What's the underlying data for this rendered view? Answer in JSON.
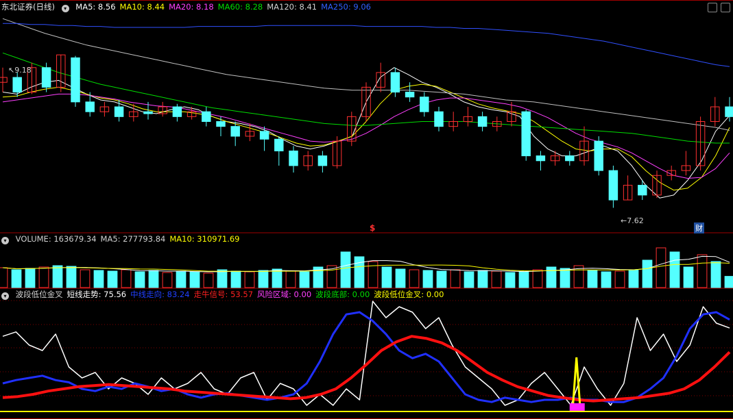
{
  "panel1": {
    "title": "东北证券(日线)",
    "ma": [
      {
        "label": "MA5: 8.56",
        "color": "#ffffff"
      },
      {
        "label": "MA10: 8.44",
        "color": "#ffff00"
      },
      {
        "label": "MA20: 8.18",
        "color": "#ff40ff"
      },
      {
        "label": "MA60: 8.28",
        "color": "#00dd00"
      },
      {
        "label": "MA120: 8.41",
        "color": "#d0d0d0"
      },
      {
        "label": "MA250: 9.06",
        "color": "#3060ff"
      }
    ],
    "high_label": "9.18",
    "low_label": "7.62",
    "marker_s": "$",
    "marker_cai": "财"
  },
  "panel2": {
    "labels": [
      {
        "label": "VOLUME: 163679.34",
        "color": "#d0d0d0"
      },
      {
        "label": "MA5: 277793.84",
        "color": "#d0d0d0"
      },
      {
        "label": "MA10: 310971.69",
        "color": "#ffff00"
      }
    ]
  },
  "panel3": {
    "labels": [
      {
        "label": "波段低位金叉",
        "color": "#d0d0d0"
      },
      {
        "label": "短线走势: 75.56",
        "color": "#ffffff"
      },
      {
        "label": "中线走向: 83.24",
        "color": "#2040ff"
      },
      {
        "label": "走牛信号: 53.57",
        "color": "#ff2020"
      },
      {
        "label": "风险区域: 0.00",
        "color": "#ff40ff"
      },
      {
        "label": "波段底部: 0.00",
        "color": "#00dd00"
      },
      {
        "label": "波段低位金叉: 0.00",
        "color": "#ffff00"
      }
    ]
  },
  "chart_data": [
    {
      "type": "candlestick",
      "ylim": [
        7.4,
        9.6
      ],
      "ma": {
        "MA5": [
          8.8,
          8.78,
          8.85,
          8.9,
          8.92,
          8.85,
          8.78,
          8.72,
          8.7,
          8.65,
          8.6,
          8.58,
          8.62,
          8.65,
          8.62,
          8.55,
          8.5,
          8.48,
          8.45,
          8.4,
          8.32,
          8.25,
          8.22,
          8.25,
          8.3,
          8.35,
          8.7,
          8.95,
          9.05,
          8.98,
          8.9,
          8.85,
          8.78,
          8.7,
          8.65,
          8.62,
          8.6,
          8.55,
          8.35,
          8.22,
          8.15,
          8.15,
          8.2,
          8.25,
          8.2,
          8.05,
          7.85,
          7.72,
          7.75,
          7.9,
          8.1,
          8.4,
          8.56
        ],
        "MA10": [
          8.75,
          8.76,
          8.8,
          8.83,
          8.85,
          8.82,
          8.78,
          8.74,
          8.72,
          8.68,
          8.63,
          8.6,
          8.6,
          8.6,
          8.58,
          8.55,
          8.5,
          8.46,
          8.42,
          8.38,
          8.33,
          8.28,
          8.25,
          8.26,
          8.3,
          8.35,
          8.5,
          8.68,
          8.82,
          8.86,
          8.88,
          8.86,
          8.8,
          8.74,
          8.68,
          8.64,
          8.61,
          8.58,
          8.5,
          8.4,
          8.3,
          8.22,
          8.2,
          8.22,
          8.22,
          8.14,
          8.0,
          7.88,
          7.8,
          7.82,
          7.93,
          8.15,
          8.44
        ],
        "MA20": [
          8.7,
          8.72,
          8.74,
          8.76,
          8.78,
          8.78,
          8.77,
          8.75,
          8.73,
          8.7,
          8.68,
          8.66,
          8.65,
          8.63,
          8.6,
          8.57,
          8.54,
          8.5,
          8.46,
          8.42,
          8.38,
          8.34,
          8.3,
          8.29,
          8.3,
          8.32,
          8.38,
          8.46,
          8.55,
          8.62,
          8.68,
          8.72,
          8.74,
          8.74,
          8.72,
          8.7,
          8.68,
          8.65,
          8.6,
          8.54,
          8.46,
          8.38,
          8.32,
          8.28,
          8.24,
          8.18,
          8.1,
          8.02,
          7.95,
          7.92,
          7.93,
          8.02,
          8.18
        ],
        "MA60": [
          9.2,
          9.15,
          9.1,
          9.05,
          9.0,
          8.96,
          8.92,
          8.88,
          8.85,
          8.82,
          8.79,
          8.76,
          8.73,
          8.7,
          8.67,
          8.64,
          8.62,
          8.6,
          8.58,
          8.56,
          8.54,
          8.52,
          8.5,
          8.48,
          8.47,
          8.46,
          8.46,
          8.47,
          8.48,
          8.49,
          8.5,
          8.5,
          8.5,
          8.5,
          8.49,
          8.48,
          8.47,
          8.46,
          8.45,
          8.44,
          8.43,
          8.42,
          8.41,
          8.4,
          8.39,
          8.38,
          8.36,
          8.34,
          8.32,
          8.3,
          8.29,
          8.28,
          8.28
        ],
        "MA120": [
          9.55,
          9.5,
          9.45,
          9.4,
          9.36,
          9.32,
          9.28,
          9.25,
          9.22,
          9.19,
          9.16,
          9.13,
          9.1,
          9.07,
          9.04,
          9.01,
          8.98,
          8.96,
          8.94,
          8.92,
          8.9,
          8.88,
          8.86,
          8.84,
          8.83,
          8.82,
          8.82,
          8.82,
          8.82,
          8.82,
          8.81,
          8.8,
          8.79,
          8.78,
          8.76,
          8.74,
          8.72,
          8.71,
          8.7,
          8.68,
          8.66,
          8.64,
          8.62,
          8.6,
          8.58,
          8.56,
          8.54,
          8.52,
          8.5,
          8.48,
          8.46,
          8.44,
          8.41
        ],
        "MA250": [
          9.5,
          9.5,
          9.49,
          9.49,
          9.48,
          9.48,
          9.47,
          9.47,
          9.46,
          9.46,
          9.46,
          9.46,
          9.46,
          9.46,
          9.47,
          9.47,
          9.47,
          9.47,
          9.47,
          9.48,
          9.48,
          9.48,
          9.48,
          9.48,
          9.48,
          9.48,
          9.47,
          9.47,
          9.47,
          9.47,
          9.47,
          9.46,
          9.46,
          9.45,
          9.45,
          9.44,
          9.43,
          9.42,
          9.41,
          9.4,
          9.38,
          9.36,
          9.34,
          9.32,
          9.29,
          9.26,
          9.23,
          9.2,
          9.17,
          9.14,
          9.11,
          9.08,
          9.06
        ]
      },
      "candles": [
        [
          8.9,
          8.95,
          9.05,
          8.8
        ],
        [
          8.95,
          8.8,
          9.0,
          8.75
        ],
        [
          8.8,
          9.05,
          9.1,
          8.78
        ],
        [
          9.05,
          8.85,
          9.1,
          8.8
        ],
        [
          8.85,
          9.18,
          9.18,
          8.8
        ],
        [
          9.15,
          8.7,
          9.17,
          8.65
        ],
        [
          8.7,
          8.6,
          8.8,
          8.55
        ],
        [
          8.6,
          8.65,
          8.7,
          8.55
        ],
        [
          8.65,
          8.55,
          8.72,
          8.5
        ],
        [
          8.55,
          8.6,
          8.68,
          8.5
        ],
        [
          8.6,
          8.58,
          8.7,
          8.52
        ],
        [
          8.58,
          8.65,
          8.7,
          8.55
        ],
        [
          8.65,
          8.55,
          8.68,
          8.5
        ],
        [
          8.55,
          8.6,
          8.65,
          8.52
        ],
        [
          8.6,
          8.5,
          8.65,
          8.45
        ],
        [
          8.5,
          8.45,
          8.55,
          8.35
        ],
        [
          8.45,
          8.35,
          8.5,
          8.25
        ],
        [
          8.35,
          8.4,
          8.48,
          8.3
        ],
        [
          8.4,
          8.32,
          8.45,
          8.2
        ],
        [
          8.32,
          8.2,
          8.35,
          8.05
        ],
        [
          8.2,
          8.05,
          8.25,
          7.98
        ],
        [
          8.05,
          8.15,
          8.2,
          8.0
        ],
        [
          8.15,
          8.05,
          8.2,
          7.98
        ],
        [
          8.05,
          8.3,
          8.35,
          8.02
        ],
        [
          8.3,
          8.55,
          8.6,
          8.25
        ],
        [
          8.55,
          8.85,
          8.9,
          8.5
        ],
        [
          8.85,
          9.0,
          9.1,
          8.8
        ],
        [
          9.0,
          8.8,
          9.05,
          8.75
        ],
        [
          8.8,
          8.75,
          8.9,
          8.7
        ],
        [
          8.75,
          8.6,
          8.8,
          8.55
        ],
        [
          8.6,
          8.45,
          8.65,
          8.4
        ],
        [
          8.45,
          8.5,
          8.6,
          8.4
        ],
        [
          8.5,
          8.55,
          8.65,
          8.45
        ],
        [
          8.55,
          8.45,
          8.6,
          8.4
        ],
        [
          8.45,
          8.5,
          8.55,
          8.4
        ],
        [
          8.5,
          8.6,
          8.7,
          8.45
        ],
        [
          8.6,
          8.15,
          8.62,
          8.1
        ],
        [
          8.15,
          8.1,
          8.2,
          8.0
        ],
        [
          8.1,
          8.15,
          8.2,
          8.05
        ],
        [
          8.15,
          8.1,
          8.2,
          8.05
        ],
        [
          8.1,
          8.3,
          8.45,
          8.05
        ],
        [
          8.3,
          8.0,
          8.35,
          7.95
        ],
        [
          8.0,
          7.7,
          8.05,
          7.62
        ],
        [
          7.7,
          7.85,
          7.95,
          7.7
        ],
        [
          7.85,
          7.75,
          7.9,
          7.7
        ],
        [
          7.75,
          7.95,
          8.0,
          7.72
        ],
        [
          7.95,
          8.0,
          8.05,
          7.9
        ],
        [
          8.0,
          8.05,
          8.2,
          7.95
        ],
        [
          8.05,
          8.5,
          8.55,
          8.0
        ],
        [
          8.5,
          8.65,
          8.75,
          8.45
        ],
        [
          8.65,
          8.55,
          8.75,
          8.5
        ]
      ]
    },
    {
      "type": "bar",
      "series_names": [
        "VOLUME",
        "MA5",
        "MA10"
      ],
      "ylim": [
        0,
        600000
      ],
      "values": [
        290000,
        260000,
        280000,
        300000,
        320000,
        310000,
        260000,
        250000,
        240000,
        260000,
        230000,
        250000,
        220000,
        240000,
        230000,
        210000,
        260000,
        240000,
        230000,
        250000,
        270000,
        240000,
        230000,
        300000,
        320000,
        520000,
        450000,
        380000,
        300000,
        270000,
        260000,
        250000,
        240000,
        260000,
        230000,
        250000,
        240000,
        220000,
        230000,
        260000,
        300000,
        280000,
        320000,
        250000,
        230000,
        240000,
        260000,
        400000,
        580000,
        520000,
        300000,
        480000,
        380000,
        163679
      ]
    },
    {
      "type": "line",
      "series_names": [
        "短线走势",
        "中线走向",
        "走牛信号",
        "波段低位金叉"
      ],
      "ylim": [
        0,
        100
      ],
      "short": [
        68,
        72,
        60,
        55,
        70,
        40,
        30,
        35,
        20,
        30,
        25,
        15,
        30,
        20,
        25,
        35,
        20,
        15,
        30,
        35,
        10,
        25,
        20,
        5,
        15,
        5,
        20,
        10,
        100,
        85,
        95,
        90,
        75,
        85,
        60,
        40,
        30,
        20,
        5,
        10,
        25,
        35,
        20,
        5,
        40,
        20,
        5,
        25,
        85,
        55,
        70,
        45,
        60,
        95,
        80,
        75.56
      ],
      "mid": [
        25,
        28,
        30,
        32,
        28,
        26,
        20,
        18,
        22,
        20,
        25,
        22,
        18,
        20,
        15,
        12,
        15,
        16,
        14,
        12,
        10,
        12,
        15,
        25,
        45,
        70,
        88,
        90,
        82,
        70,
        55,
        48,
        52,
        45,
        30,
        15,
        10,
        8,
        12,
        10,
        8,
        10,
        10,
        12,
        10,
        10,
        8,
        8,
        12,
        20,
        30,
        50,
        75,
        88,
        90,
        83.24
      ],
      "signal": [
        12,
        13,
        15,
        18,
        20,
        22,
        23,
        24,
        23,
        22,
        21,
        20,
        18,
        17,
        16,
        15,
        14,
        13,
        12,
        11,
        12,
        15,
        20,
        30,
        42,
        55,
        63,
        68,
        66,
        62,
        55,
        45,
        35,
        28,
        22,
        18,
        14,
        12,
        10,
        9,
        10,
        11,
        12,
        14,
        16,
        20,
        28,
        40,
        53.57
      ],
      "golden_cross_index": 43
    }
  ]
}
